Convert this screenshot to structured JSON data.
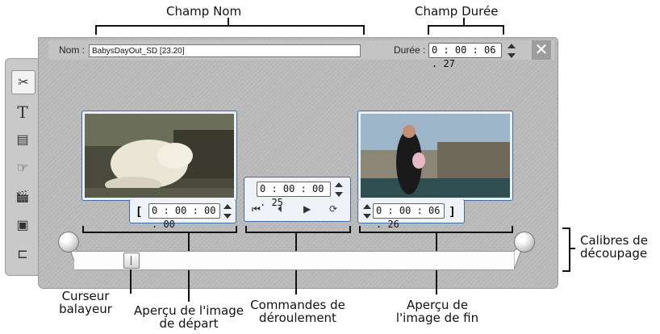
{
  "callouts": {
    "champ_nom": "Champ Nom",
    "champ_duree": "Champ Durée",
    "calibres": "Calibres de\ndécoupage",
    "curseur": "Curseur\nbalayeur",
    "apercu_depart": "Aperçu de l'image\nde départ",
    "commandes": "Commandes de\ndéroulement",
    "apercu_fin": "Aperçu de\nl'image de fin"
  },
  "header": {
    "name_label": "Nom :",
    "name_value": "BabysDayOut_SD [23.20]",
    "duration_label": "Durée :",
    "duration_value": "0 : 00 : 06 . 27"
  },
  "sidebar": {
    "items": [
      {
        "icon": "video-edit-icon",
        "glyph": "✂"
      },
      {
        "icon": "title-icon",
        "glyph": "T"
      },
      {
        "icon": "disc-menu-icon",
        "glyph": "▤"
      },
      {
        "icon": "touch-icon",
        "glyph": "☞"
      },
      {
        "icon": "clapper-icon",
        "glyph": "🎬"
      },
      {
        "icon": "frame-icon",
        "glyph": "▣"
      },
      {
        "icon": "audio-icon",
        "glyph": "⊏"
      }
    ]
  },
  "start_preview": {
    "bracket": "[",
    "time": "0 : 00 : 00 . 00"
  },
  "end_preview": {
    "bracket": "]",
    "time": "0 : 00 : 06 . 26"
  },
  "transport": {
    "time": "0 : 00 : 00 . 25",
    "buttons": [
      "⏮",
      "⏴",
      "▶",
      "⟳"
    ]
  },
  "slider": {
    "scrubber_position_fraction": 0.12
  }
}
